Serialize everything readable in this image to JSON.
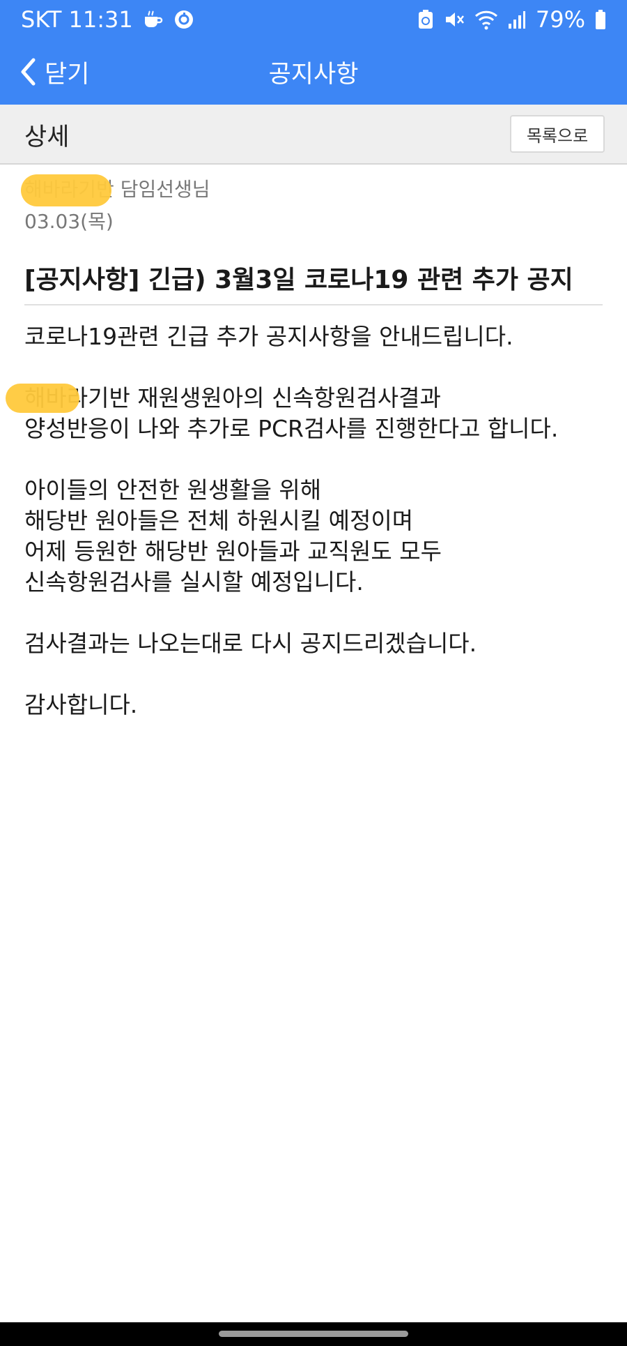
{
  "status_bar": {
    "carrier_time": "SKT 11:31",
    "battery": "79%"
  },
  "app_bar": {
    "back_label": "닫기",
    "title": "공지사항"
  },
  "sub_header": {
    "title": "상세",
    "list_button": "목록으로"
  },
  "post": {
    "author": "해바라기반 담임선생님",
    "date": "03.03(목)",
    "title": "[공지사항] 긴급) 3월3일 코로나19 관련 추가 공지",
    "body": [
      "코로나19관련 긴급 추가 공지사항을 안내드립니다.",
      "",
      "해바라기반 재원생원아의 신속항원검사결과",
      "양성반응이 나와 추가로 PCR검사를 진행한다고 합니다.",
      "",
      "아이들의 안전한 원생활을 위해",
      "해당반 원아들은 전체 하원시킬 예정이며",
      "어제 등원한 해당반 원아들과 교직원도 모두",
      "신속항원검사를 실시할 예정입니다.",
      "",
      "검사결과는 나오는대로 다시 공지드리겠습니다.",
      "",
      "감사합니다."
    ]
  },
  "colors": {
    "accent": "#3d86f5",
    "redaction": "#ffc93c"
  }
}
